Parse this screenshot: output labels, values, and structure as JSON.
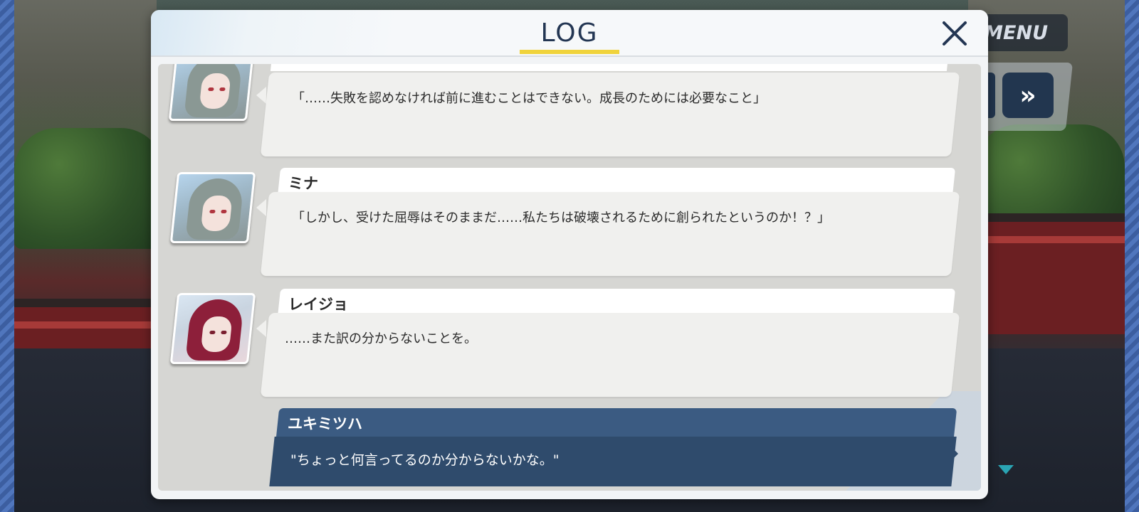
{
  "menu": {
    "label": "MENU"
  },
  "controls": {
    "fast_forward_icon": "double-chevron-right-icon",
    "fast_forward_glyph": "»",
    "scroll_down_icon": "triangle-down-icon"
  },
  "log": {
    "title": "LOG",
    "close_icon": "close-icon",
    "entries": [
      {
        "speaker": "",
        "avatar": "mina",
        "text": "「……失敗を認めなければ前に進むことはできない。成長のためには必要なこと」"
      },
      {
        "speaker": "ミナ",
        "avatar": "mina",
        "text": "「しかし、受けた屈辱はそのままだ……私たちは破壊されるために創られたというのか！？」"
      },
      {
        "speaker": "レイジョ",
        "avatar": "reijo",
        "text": "……また訳の分からないことを。"
      },
      {
        "speaker": "ユキミツハ",
        "avatar": "",
        "text": "\"ちょっと何言ってるのか分からないかな。\""
      }
    ]
  },
  "colors": {
    "title_text": "#233653",
    "title_underline": "#f0d33c",
    "player_name_bar": "#3b5b82",
    "player_bubble": "#2f4b6c",
    "scroll_indicator": "#2aa4b3"
  }
}
